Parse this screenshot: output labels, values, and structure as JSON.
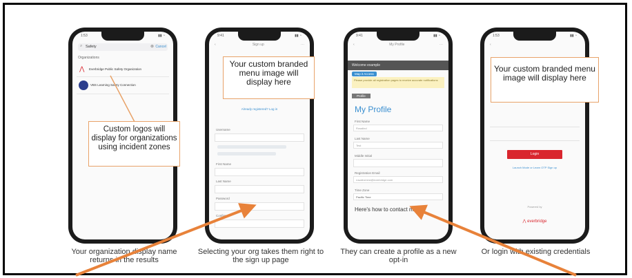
{
  "phones": [
    {
      "search_text": "Safety",
      "cancel_label": "Cancel",
      "section_label": "Organizations",
      "results": [
        {
          "name": "Everbridge Public Safety Organization"
        },
        {
          "name": "VBS Learning Safety Connection"
        }
      ],
      "callout": "Custom logos will display for organizations using incident zones",
      "caption": "Your organization display name returns in the results"
    },
    {
      "nav_title": "Sign up",
      "callout": "Your custom branded menu image will display here",
      "link": "Already registered? Log in",
      "fields": [
        "Username",
        "First Name",
        "Last Name",
        "Password",
        "Confirm"
      ],
      "caption": "Selecting your org takes them right to the sign up page"
    },
    {
      "nav_title": "My Profile",
      "header_bar": "Welcome example",
      "tag": "Map it Access",
      "notice": "Please provide all registration pages to receive accurate notifications",
      "step": "Profile",
      "title": "My Profile",
      "fields": [
        {
          "label": "First Name",
          "value": "Rosalind"
        },
        {
          "label": "Last Name",
          "value": "Test"
        },
        {
          "label": "Middle Initial",
          "value": ""
        },
        {
          "label": "Registration Email",
          "value": "rosalind.test@everbridge.com"
        },
        {
          "label": "Time Zone",
          "value": "Pacific Time"
        }
      ],
      "contact": "Here's how to contact me",
      "caption": "They can create a profile as a new opt-in"
    },
    {
      "callout": "Your custom branded menu image will display here",
      "login_button": "Login",
      "link": "Launch Mode or Learn OTP Sign up",
      "footer": "Powered by",
      "brand": "everbridge",
      "caption": "Or login with existing credentials"
    }
  ],
  "colors": {
    "accent": "#e8823a",
    "callout_border": "#e8a268",
    "login": "#d9262e",
    "brand": "#d9262e",
    "profile_title": "#3a8fd0"
  }
}
